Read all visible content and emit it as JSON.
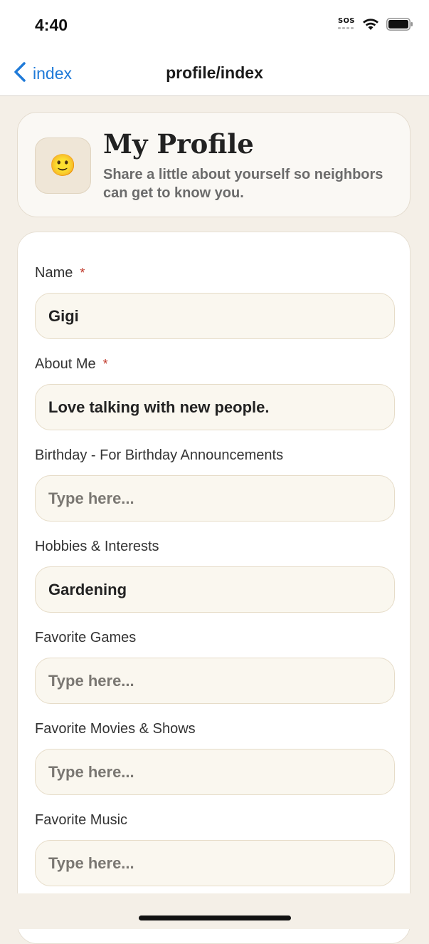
{
  "status_bar": {
    "time": "4:40",
    "sos": "SOS"
  },
  "nav": {
    "back_label": "index",
    "title": "profile/index"
  },
  "header": {
    "avatar_emoji": "🙂",
    "title": "My Profile",
    "subtitle": "Share a little about yourself so neighbors can get to know you."
  },
  "form": {
    "fields": [
      {
        "label": "Name",
        "required": "*",
        "value": "Gigi",
        "placeholder": ""
      },
      {
        "label": "About Me",
        "required": "*",
        "value": "Love talking with new people.",
        "placeholder": ""
      },
      {
        "label": "Birthday - For Birthday Announcements",
        "value": "",
        "placeholder": "Type here..."
      },
      {
        "label": "Hobbies & Interests",
        "value": "Gardening",
        "placeholder": ""
      },
      {
        "label": "Favorite Games",
        "value": "",
        "placeholder": "Type here..."
      },
      {
        "label": "Favorite Movies & Shows",
        "value": "",
        "placeholder": "Type here..."
      },
      {
        "label": "Favorite Music",
        "value": "",
        "placeholder": "Type here..."
      }
    ]
  },
  "colors": {
    "accent": "#1f7ad8",
    "required": "#c0392b",
    "background": "#f4efe7"
  }
}
